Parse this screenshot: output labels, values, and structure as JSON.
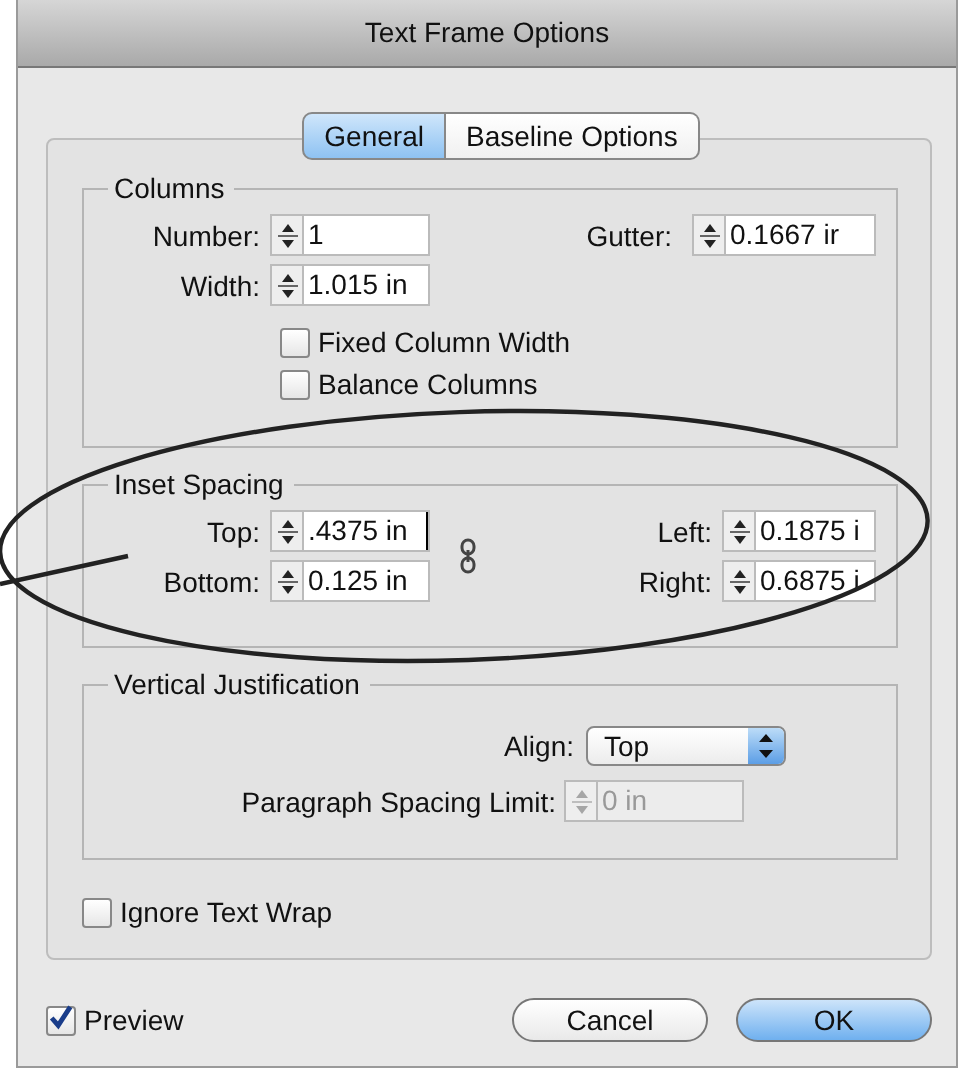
{
  "window": {
    "title": "Text Frame Options"
  },
  "tabs": [
    {
      "label": "General",
      "selected": true
    },
    {
      "label": "Baseline Options",
      "selected": false
    }
  ],
  "columns": {
    "title": "Columns",
    "rows": [
      [
        {
          "label": "Number:",
          "value": "1"
        },
        {
          "label": "Gutter:",
          "value": "0.1667 ir"
        }
      ],
      [
        {
          "label": "Width:",
          "value": "1.015 in"
        }
      ]
    ],
    "checkboxes": [
      {
        "label": "Fixed Column Width",
        "checked": false
      },
      {
        "label": "Balance Columns",
        "checked": false
      }
    ]
  },
  "inset_spacing": {
    "title": "Inset Spacing",
    "rows": [
      [
        {
          "label": "Top:",
          "value": ".4375 in",
          "focused": true
        },
        {
          "label": "Left:",
          "value": "0.1875 i",
          "focused": false
        }
      ],
      [
        {
          "label": "Bottom:",
          "value": "0.125 in",
          "focused": false
        },
        {
          "label": "Right:",
          "value": "0.6875 i",
          "focused": false
        }
      ]
    ]
  },
  "vertical_justification": {
    "title": "Vertical Justification",
    "align": {
      "label": "Align:",
      "value": "Top"
    },
    "paragraph_spacing_limit": {
      "label": "Paragraph Spacing Limit:",
      "value": "0 in",
      "disabled": true
    }
  },
  "ignore_text_wrap": {
    "label": "Ignore Text Wrap",
    "checked": false
  },
  "preview": {
    "label": "Preview",
    "checked": true
  },
  "buttons": [
    {
      "label": "Cancel",
      "default": false
    },
    {
      "label": "OK",
      "default": true
    }
  ]
}
